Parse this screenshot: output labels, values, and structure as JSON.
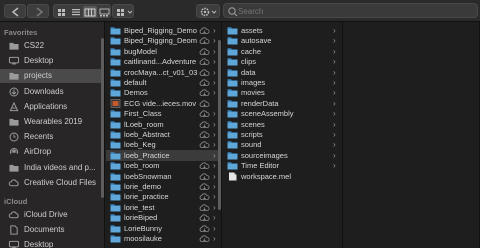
{
  "toolbar": {
    "search_placeholder": "Search"
  },
  "sidebar": {
    "favorites_heading": "Favorites",
    "icloud_heading": "iCloud",
    "favorites": [
      {
        "label": "CS22",
        "icon": "folder-icon"
      },
      {
        "label": "Desktop",
        "icon": "desktop-icon"
      },
      {
        "label": "projects",
        "icon": "folder-icon",
        "selected": true
      },
      {
        "label": "Downloads",
        "icon": "downloads-icon"
      },
      {
        "label": "Applications",
        "icon": "applications-icon"
      },
      {
        "label": "Wearables 2019",
        "icon": "folder-icon"
      },
      {
        "label": "Recents",
        "icon": "recents-icon"
      },
      {
        "label": "AirDrop",
        "icon": "airdrop-icon"
      },
      {
        "label": "India videos and p...",
        "icon": "folder-icon"
      },
      {
        "label": "Creative Cloud Files",
        "icon": "creative-cloud-icon"
      }
    ],
    "icloud": [
      {
        "label": "iCloud Drive",
        "icon": "icloud-icon"
      },
      {
        "label": "Documents",
        "icon": "documents-icon"
      },
      {
        "label": "Desktop",
        "icon": "desktop-icon"
      }
    ]
  },
  "column1": [
    {
      "name": "Biped_Rigging_Demo",
      "cloud": true,
      "chevron": true
    },
    {
      "name": "Biped_Rigging_Deom",
      "cloud": true,
      "chevron": true
    },
    {
      "name": "bugModel",
      "cloud": true,
      "chevron": true
    },
    {
      "name": "caitlinand...Adventure",
      "cloud": true,
      "chevron": true
    },
    {
      "name": "crocMaya...ct_v01_03",
      "cloud": true,
      "chevron": true
    },
    {
      "name": "default",
      "cloud": true,
      "chevron": true
    },
    {
      "name": "Demos",
      "cloud": true,
      "chevron": true
    },
    {
      "name": "ECG vide...ieces.mov",
      "file": true,
      "cloud": true,
      "chevron": false
    },
    {
      "name": "First_Class",
      "cloud": true,
      "chevron": true
    },
    {
      "name": "lLoeb_room",
      "cloud": true,
      "chevron": true
    },
    {
      "name": "loeb_Abstract",
      "cloud": true,
      "chevron": true
    },
    {
      "name": "loeb_Keg",
      "cloud": true,
      "chevron": true
    },
    {
      "name": "loeb_Practice",
      "cloud": false,
      "chevron": true,
      "selected": true
    },
    {
      "name": "loeb_room",
      "cloud": true,
      "chevron": true
    },
    {
      "name": "loebSnowman",
      "cloud": true,
      "chevron": true
    },
    {
      "name": "lorie_demo",
      "cloud": true,
      "chevron": true
    },
    {
      "name": "lorie_practice",
      "cloud": true,
      "chevron": true
    },
    {
      "name": "lorie_test",
      "cloud": true,
      "chevron": true
    },
    {
      "name": "lorieBiped",
      "cloud": true,
      "chevron": true
    },
    {
      "name": "LorieBunny",
      "cloud": true,
      "chevron": true
    },
    {
      "name": "moosilauke",
      "cloud": true,
      "chevron": true
    }
  ],
  "column2": [
    {
      "name": "assets",
      "chevron": true
    },
    {
      "name": "autosave",
      "chevron": true
    },
    {
      "name": "cache",
      "chevron": true
    },
    {
      "name": "clips",
      "chevron": true
    },
    {
      "name": "data",
      "chevron": true
    },
    {
      "name": "images",
      "chevron": true
    },
    {
      "name": "movies",
      "chevron": true
    },
    {
      "name": "renderData",
      "chevron": true
    },
    {
      "name": "sceneAssembly",
      "chevron": true
    },
    {
      "name": "scenes",
      "chevron": true
    },
    {
      "name": "scripts",
      "chevron": true
    },
    {
      "name": "sound",
      "chevron": true
    },
    {
      "name": "sourceimages",
      "chevron": true
    },
    {
      "name": "Time Editor",
      "chevron": true
    },
    {
      "name": "workspace.mel",
      "file": true,
      "chevron": false
    }
  ],
  "colors": {
    "folder": "#5fa6d9",
    "folder_dark": "#3f87be",
    "selected_sidebar": "#4a4a4a",
    "selected_row": "#3b3b3b"
  }
}
